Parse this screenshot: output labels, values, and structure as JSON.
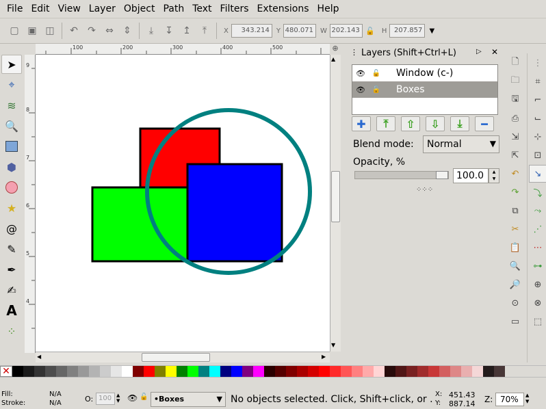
{
  "menu": [
    "File",
    "Edit",
    "View",
    "Layer",
    "Object",
    "Path",
    "Text",
    "Filters",
    "Extensions",
    "Help"
  ],
  "toolbar": {
    "x_label": "X",
    "x_value": "343.214",
    "y_label": "Y",
    "y_value": "480.071",
    "w_label": "W",
    "w_value": "202.143",
    "h_label": "H",
    "h_value": "207.857"
  },
  "ruler": {
    "top_ticks": [
      "100",
      "200",
      "300",
      "400",
      "500"
    ],
    "left_ticks": [
      "9",
      "8",
      "7",
      "6",
      "5",
      "4"
    ]
  },
  "layers_panel": {
    "title": "Layers (Shift+Ctrl+L)",
    "layers": [
      {
        "name": "Window (c-)",
        "selected": false
      },
      {
        "name": "Boxes",
        "selected": true
      }
    ],
    "blend_label": "Blend mode:",
    "blend_value": "Normal",
    "opacity_label": "Opacity, %",
    "opacity_value": "100.0"
  },
  "canvas_shapes": {
    "red_color": "#ff0000",
    "green_color": "#00ff00",
    "blue_color": "#0000ff",
    "circle_stroke": "#008080"
  },
  "palette": [
    "#000000",
    "#1a1a1a",
    "#333333",
    "#4d4d4d",
    "#666666",
    "#808080",
    "#999999",
    "#b3b3b3",
    "#cccccc",
    "#e6e6e6",
    "#ffffff",
    "#800000",
    "#ff0000",
    "#808000",
    "#ffff00",
    "#008000",
    "#00ff00",
    "#008080",
    "#00ffff",
    "#000080",
    "#0000ff",
    "#800080",
    "#ff00ff",
    "#2b0000",
    "#550000",
    "#800000",
    "#aa0000",
    "#d40000",
    "#ff0000",
    "#ff2a2a",
    "#ff5555",
    "#ff8080",
    "#ffaaaa",
    "#ffd5d5",
    "#280b0b",
    "#501616",
    "#782121",
    "#a02c2c",
    "#c83737",
    "#d35f5f",
    "#de8787",
    "#e9afaf",
    "#f4d7d7",
    "#241c1c",
    "#483737"
  ],
  "status": {
    "fill_label": "Fill:",
    "fill_value": "N/A",
    "stroke_label": "Stroke:",
    "stroke_value": "N/A",
    "opacity_label": "O:",
    "opacity_value": "100",
    "layer_value": "•Boxes",
    "message": "No objects selected. Click, Shift+click, or ...",
    "x_label": "X:",
    "x_value": "451.43",
    "y_label": "Y:",
    "y_value": "887.14",
    "zoom_label": "Z:",
    "zoom_value": "70%"
  }
}
